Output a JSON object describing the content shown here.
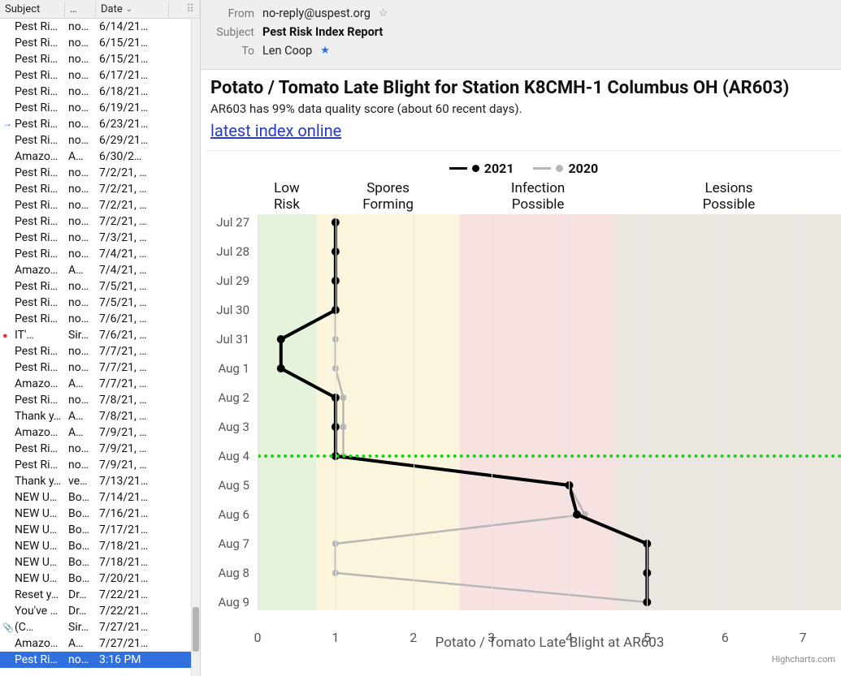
{
  "list": {
    "columns": {
      "subject": "Subject",
      "mid": "…",
      "date": "Date"
    },
    "rows": [
      {
        "s": "Pest Ri…",
        "f": "no…",
        "d": "6/14/21…"
      },
      {
        "s": "Pest Ri…",
        "f": "no…",
        "d": "6/15/21…"
      },
      {
        "s": "Pest Ri…",
        "f": "no…",
        "d": "6/15/21…"
      },
      {
        "s": "Pest Ri…",
        "f": "no…",
        "d": "6/17/21…"
      },
      {
        "s": "Pest Ri…",
        "f": "no…",
        "d": "6/18/21…"
      },
      {
        "s": "Pest Ri…",
        "f": "no…",
        "d": "6/19/21…"
      },
      {
        "s": "Pest Ri…",
        "f": "no…",
        "d": "6/23/21…",
        "flag": "arrow"
      },
      {
        "s": "Pest Ri…",
        "f": "no…",
        "d": "6/29/21…"
      },
      {
        "s": "Amazo…",
        "f": "A…",
        "d": "6/30/2…"
      },
      {
        "s": "Pest Ri…",
        "f": "no…",
        "d": "7/2/21, …"
      },
      {
        "s": "Pest Ri…",
        "f": "no…",
        "d": "7/2/21, …"
      },
      {
        "s": "Pest Ri…",
        "f": "no…",
        "d": "7/2/21, …"
      },
      {
        "s": "Pest Ri…",
        "f": "no…",
        "d": "7/2/21, …"
      },
      {
        "s": "Pest Ri…",
        "f": "no…",
        "d": "7/3/21, …"
      },
      {
        "s": "Pest Ri…",
        "f": "no…",
        "d": "7/4/21, …"
      },
      {
        "s": "Amazo…",
        "f": "A…",
        "d": "7/4/21, …"
      },
      {
        "s": "Pest Ri…",
        "f": "no…",
        "d": "7/5/21, …"
      },
      {
        "s": "Pest Ri…",
        "f": "no…",
        "d": "7/5/21, …"
      },
      {
        "s": "Pest Ri…",
        "f": "no…",
        "d": "7/6/21, …"
      },
      {
        "s": "IT'…",
        "f": "Sir…",
        "d": "7/6/21, …",
        "flag": "red"
      },
      {
        "s": "Pest Ri…",
        "f": "no…",
        "d": "7/7/21, …"
      },
      {
        "s": "Pest Ri…",
        "f": "no…",
        "d": "7/7/21, …"
      },
      {
        "s": "Amazo…",
        "f": "A…",
        "d": "7/7/21, …"
      },
      {
        "s": "Pest Ri…",
        "f": "no…",
        "d": "7/8/21, …"
      },
      {
        "s": "Thank y…",
        "f": "A…",
        "d": "7/8/21, …"
      },
      {
        "s": "Amazo…",
        "f": "A…",
        "d": "7/9/21, …"
      },
      {
        "s": "Pest Ri…",
        "f": "no…",
        "d": "7/9/21, …"
      },
      {
        "s": "Pest Ri…",
        "f": "no…",
        "d": "7/9/21, …"
      },
      {
        "s": "Thank y…",
        "f": "ve…",
        "d": "7/13/21…"
      },
      {
        "s": "NEW U…",
        "f": "Bo…",
        "d": "7/14/21…"
      },
      {
        "s": "NEW U…",
        "f": "Bo…",
        "d": "7/16/21…"
      },
      {
        "s": "NEW U…",
        "f": "Bo…",
        "d": "7/17/21…"
      },
      {
        "s": "NEW U…",
        "f": "Bo…",
        "d": "7/18/21…"
      },
      {
        "s": "NEW U…",
        "f": "Bo…",
        "d": "7/18/21…"
      },
      {
        "s": "NEW U…",
        "f": "Bo…",
        "d": "7/20/21…"
      },
      {
        "s": "Reset y…",
        "f": "Dr…",
        "d": "7/22/21…"
      },
      {
        "s": "You've …",
        "f": "Dr…",
        "d": "7/22/21…"
      },
      {
        "s": "(C…",
        "f": "Sir…",
        "d": "7/27/21…",
        "flag": "clip"
      },
      {
        "s": "Amazo…",
        "f": "A…",
        "d": "7/27/21…"
      },
      {
        "s": "Pest Ri…",
        "f": "no…",
        "d": "3:16 PM",
        "sel": true
      }
    ]
  },
  "header": {
    "from_lbl": "From",
    "from_val": "no-reply@uspest.org",
    "subject_lbl": "Subject",
    "subject_val": "Pest Risk Index Report",
    "to_lbl": "To",
    "to_val": "Len Coop"
  },
  "body": {
    "title": "Potato / Tomato Late Blight for Station K8CMH-1 Columbus OH (AR603)",
    "subtitle": "AR603 has 99% data quality score (about 60 recent days).",
    "link": "latest index online"
  },
  "chart_data": {
    "type": "line",
    "orientation": "vertical-date",
    "title": "",
    "xlabel": "Potato / Tomato Late Blight at AR603",
    "credit": "Highcharts.com",
    "xlim": [
      0,
      7.5
    ],
    "x_ticks": [
      0,
      1,
      2,
      3,
      4,
      5,
      6,
      7
    ],
    "categories": [
      "Jul 27",
      "Jul 28",
      "Jul 29",
      "Jul 30",
      "Jul 31",
      "Aug 1",
      "Aug 2",
      "Aug 3",
      "Aug 4",
      "Aug 5",
      "Aug 6",
      "Aug 7",
      "Aug 8",
      "Aug 9"
    ],
    "today_index": 8,
    "bands": [
      {
        "label": "Low Risk",
        "from": 0,
        "to": 0.75,
        "color": "#cfe7bf"
      },
      {
        "label": "Spores Forming",
        "from": 0.75,
        "to": 2.6,
        "color": "#f6ecc0"
      },
      {
        "label": "Infection Possible",
        "from": 2.6,
        "to": 4.6,
        "color": "#f3c9c9"
      },
      {
        "label": "Lesions Possible",
        "from": 4.6,
        "to": 7.5,
        "color": "#ddd2c8"
      }
    ],
    "series": [
      {
        "name": "2021",
        "color": "#000",
        "width": 4,
        "values": [
          1.0,
          1.0,
          1.0,
          1.0,
          0.3,
          0.3,
          1.0,
          1.0,
          1.0,
          4.0,
          4.1,
          5.0,
          5.0,
          5.0
        ]
      },
      {
        "name": "2020",
        "color": "#b7b7b7",
        "width": 2.5,
        "values": [
          1.0,
          1.0,
          1.0,
          1.0,
          1.0,
          1.0,
          1.1,
          1.1,
          1.1,
          4.0,
          4.2,
          1.0,
          1.0,
          5.0
        ]
      }
    ]
  }
}
